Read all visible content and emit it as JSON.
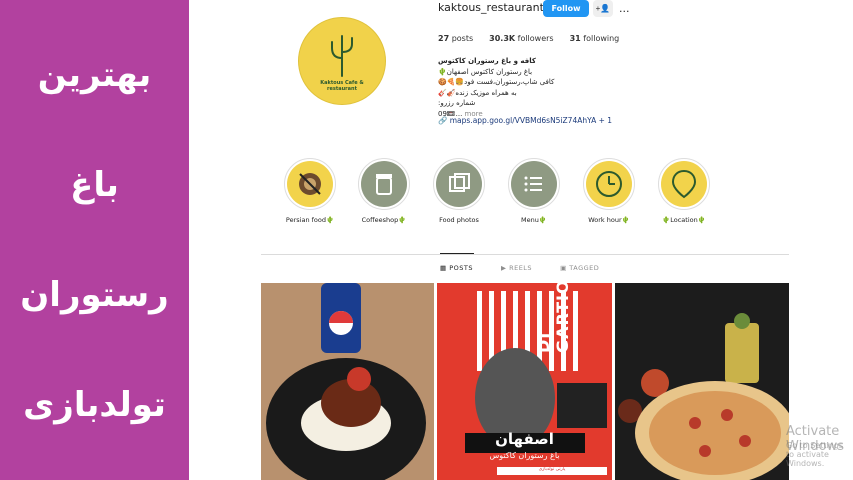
{
  "overlay": {
    "words": [
      "بهترین",
      "باغ",
      "رستوران",
      "تولدبازی"
    ]
  },
  "profile": {
    "username": "kaktous_restaurant",
    "follow_label": "Follow",
    "add_user_icon": "add-user-icon",
    "more_icon": "...",
    "avatar_text": "Kaktous Cafe & restaurant",
    "stats": {
      "posts": "27",
      "posts_label": "posts",
      "followers": "30.3K",
      "followers_label": "followers",
      "following": "31",
      "following_label": "following"
    },
    "bio": {
      "name": "کافه و باغ رستوران کاکتوس",
      "line1": "باغ رستوران کاکتوس اصفهان🌵",
      "line2": "کافی شاپ،رستوران،فست فود🍔🍕🍪",
      "line3": "به همراه موزیک زنده🎻🎸",
      "line4": "شماره رزرو:",
      "line5": "09📼...",
      "more": "more"
    },
    "link": "maps.app.goo.gl/VVBMd6sN5iZ74AhYA + 1"
  },
  "highlights": [
    {
      "label": "Persian food🌵",
      "icon": "persian-food-icon",
      "color": "#f2d34b"
    },
    {
      "label": "Coffeeshop🌵",
      "icon": "coffee-cup-icon",
      "color": "#8f9a83"
    },
    {
      "label": "Food photos",
      "icon": "photos-icon",
      "color": "#8f9a83"
    },
    {
      "label": "Menu🌵",
      "icon": "menu-list-icon",
      "color": "#8f9a83"
    },
    {
      "label": "Work hour🌵",
      "icon": "work-hour-icon",
      "color": "#f2d34b"
    },
    {
      "label": "🌵Location🌵",
      "icon": "location-pin-icon",
      "color": "#f2d34b"
    }
  ],
  "tabs": [
    {
      "label": "POSTS",
      "icon": "grid-icon",
      "active": true
    },
    {
      "label": "REELS",
      "icon": "reels-icon",
      "active": false
    },
    {
      "label": "TAGGED",
      "icon": "tagged-icon",
      "active": false
    }
  ],
  "posts": {
    "post2": {
      "dj_text": "DJ GARTIO",
      "city": "اصفهان",
      "garden": "باغ رستوران کاکتوس",
      "strip": "پارتی تولدبازی"
    }
  },
  "watermark": {
    "line1": "Activate Windows",
    "line2": "Go to Settings to activate Windows."
  },
  "colors": {
    "overlay_bg": "#b2419f",
    "follow_blue": "#2196f3",
    "avatar_yellow": "#f1d24a"
  }
}
